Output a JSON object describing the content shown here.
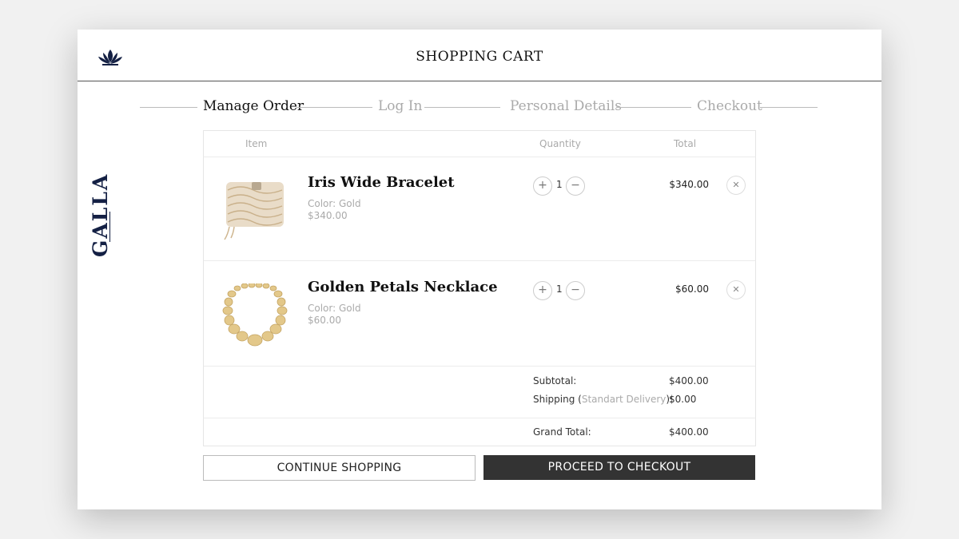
{
  "header": {
    "title": "SHOPPING CART",
    "logo_icon": "lotus-icon",
    "brand": "GALLA"
  },
  "steps": [
    "Manage Order",
    "Log In",
    "Personal Details",
    "Checkout"
  ],
  "active_step": "Manage Order",
  "cart": {
    "columns": {
      "item": "Item",
      "quantity": "Quantity",
      "total": "Total"
    },
    "items": [
      {
        "name": "Iris Wide Bracelet",
        "color": "Color: Gold",
        "unit_price": "$340.00",
        "quantity": "1",
        "total": "$340.00",
        "image_icon": "bracelet-image"
      },
      {
        "name": "Golden Petals Necklace",
        "color": "Color: Gold",
        "unit_price": "$60.00",
        "quantity": "1",
        "total": "$60.00",
        "image_icon": "necklace-image"
      }
    ],
    "subtotal_label": "Subtotal:",
    "subtotal": "$400.00",
    "shipping_label_prefix": "Shipping (",
    "shipping_method": "Standart Delivery",
    "shipping_label_suffix": "):",
    "shipping": "$0.00",
    "grand_total_label": "Grand Total:",
    "grand_total": "$400.00"
  },
  "buttons": {
    "continue": "CONTINUE SHOPPING",
    "checkout": "PROCEED TO CHECKOUT"
  },
  "colors": {
    "brand": "#142044",
    "checkout_button": "#333333",
    "muted_text": "#aaaaaa"
  }
}
